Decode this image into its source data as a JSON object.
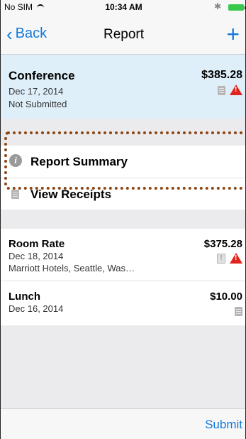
{
  "statusbar": {
    "carrier": "No SIM",
    "time": "10:34 AM"
  },
  "navbar": {
    "back_label": "Back",
    "title": "Report",
    "add_label": "+"
  },
  "report": {
    "title": "Conference",
    "date": "Dec 17, 2014",
    "status": "Not Submitted",
    "amount": "$385.28"
  },
  "menu": {
    "summary_label": "Report Summary",
    "receipts_label": "View Receipts"
  },
  "expenses": [
    {
      "title": "Room Rate",
      "date": "Dec 18, 2014",
      "vendor": "Marriott Hotels, Seattle, Was…",
      "amount": "$375.28"
    },
    {
      "title": "Lunch",
      "date": "Dec 16, 2014",
      "amount": "$10.00"
    }
  ],
  "toolbar": {
    "submit_label": "Submit"
  },
  "colors": {
    "accent": "#1479d8",
    "warning": "#e0241c",
    "highlight_row": "#dfeffa",
    "annotation": "#8b4513"
  },
  "icons": [
    "wifi-icon",
    "bluetooth-icon",
    "battery-icon",
    "chevron-left-icon",
    "plus-icon",
    "receipt-icon",
    "warning-icon",
    "info-icon"
  ]
}
